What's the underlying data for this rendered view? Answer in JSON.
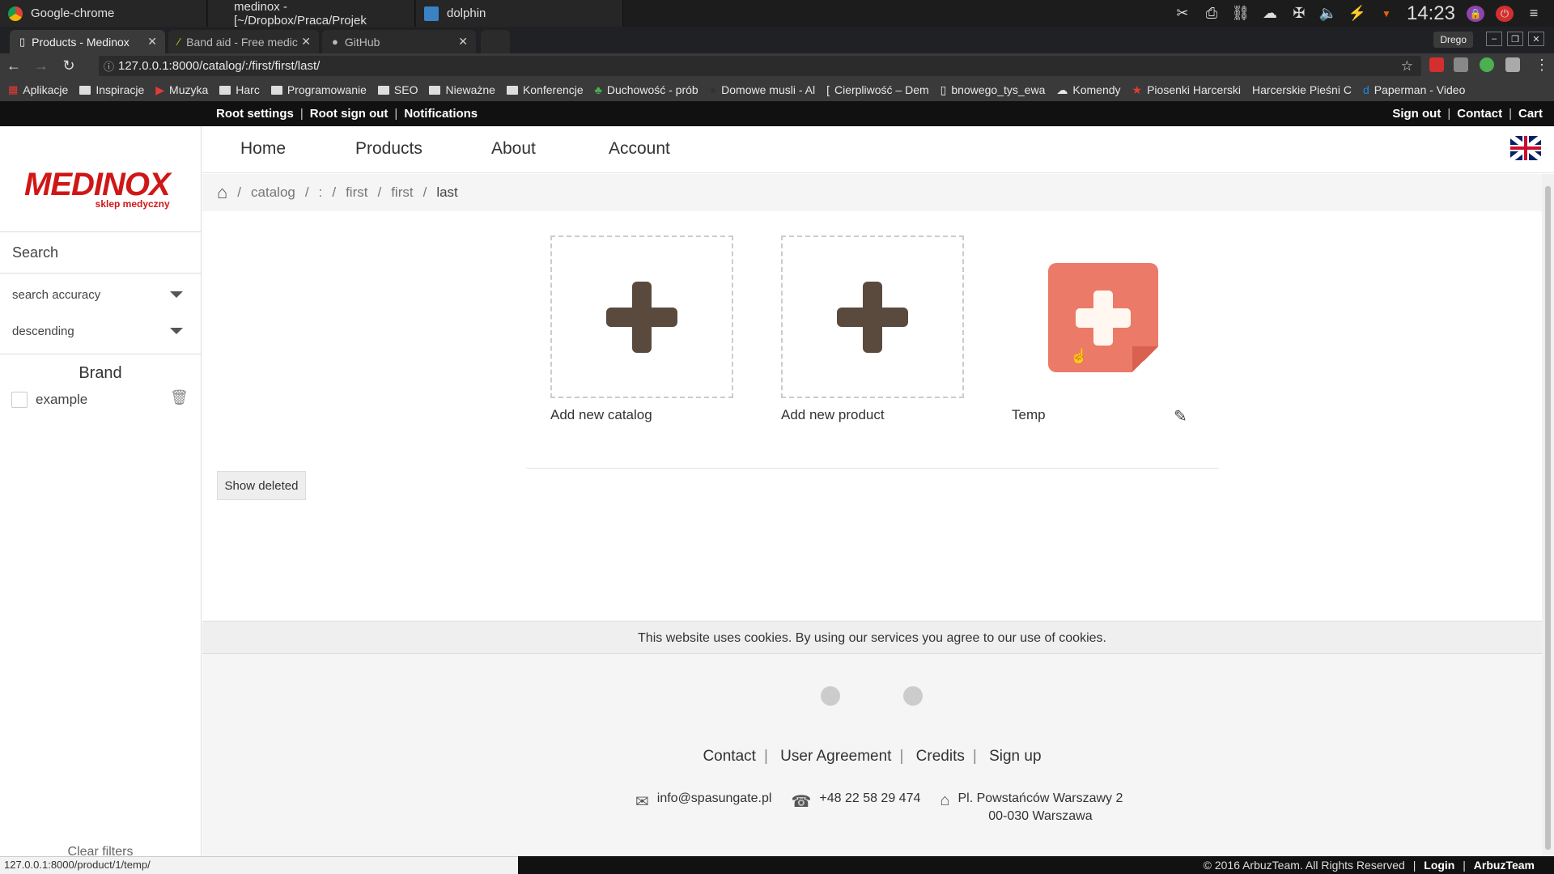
{
  "os": {
    "tasks": [
      "Google-chrome",
      "medinox - [~/Dropbox/Praca/Projek",
      "dolphin"
    ],
    "clock": "14:23"
  },
  "browser": {
    "tabs": [
      "Products - Medinox",
      "Band aid - Free medic",
      "GitHub"
    ],
    "profile": "Drego",
    "url": "127.0.0.1:8000/catalog/:/first/first/last/",
    "bookmarks": [
      "Aplikacje",
      "Inspiracje",
      "Muzyka",
      "Harc",
      "Programowanie",
      "SEO",
      "Nieważne",
      "Konferencje",
      "Duchowość - prób",
      "Domowe musli - Al",
      "Cierpliwość – Dem",
      "bnowego_tys_ewa",
      "Komendy",
      "Piosenki Harcerski",
      "Harcerskie Pieśni C",
      "Paperman - Video"
    ],
    "status_url": "127.0.0.1:8000/product/1/temp/"
  },
  "site_top": {
    "left": [
      "Root settings",
      "Root sign out",
      "Notifications"
    ],
    "right": [
      "Sign out",
      "Contact",
      "Cart"
    ]
  },
  "sidebar": {
    "logo_word": "MEDINOX",
    "logo_sub": "sklep medyczny",
    "search_placeholder": "Search",
    "accuracy": "search accuracy",
    "order": "descending",
    "brand_title": "Brand",
    "brand_items": [
      "example"
    ],
    "clear_filters": "Clear filters"
  },
  "nav": {
    "items": [
      "Home",
      "Products",
      "About",
      "Account"
    ]
  },
  "breadcrumb": [
    "catalog",
    ":",
    "first",
    "first",
    "last"
  ],
  "content": {
    "add_catalog": "Add new catalog",
    "add_product": "Add new product",
    "product_name": "Temp",
    "show_deleted": "Show deleted"
  },
  "cookie_text": "This website uses cookies. By using our services you agree to our use of cookies.",
  "footer": {
    "links": [
      "Contact",
      "User Agreement",
      "Credits",
      "Sign up"
    ],
    "email": "info@spasungate.pl",
    "phone": "+48 22 58 29 474",
    "address_line1": "Pl. Powstańców Warszawy 2",
    "address_line2": "00-030 Warszawa",
    "copyright": "© 2016 ArbuzTeam. All Rights Reserved",
    "login": "Login",
    "team": "ArbuzTeam"
  },
  "colors": {
    "brand_red": "#d01717",
    "plus_dark": "#5a4a3e",
    "temp_salmon": "#ec7a68"
  }
}
